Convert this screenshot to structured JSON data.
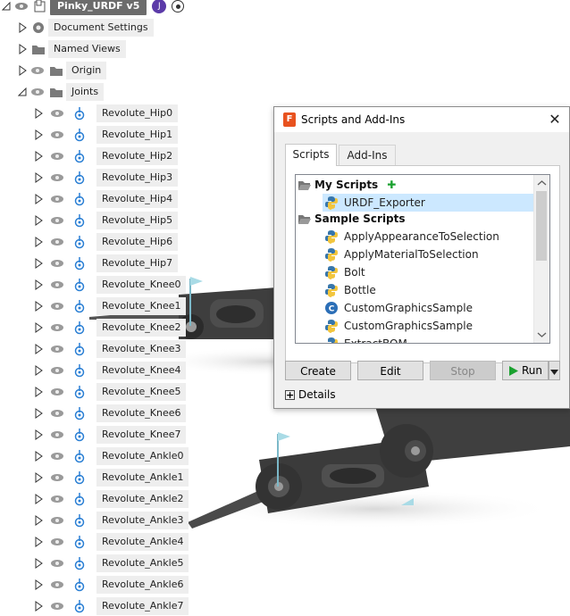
{
  "browser": {
    "root_label": "Pinky_URDF v5",
    "items": [
      {
        "label": "Document Settings",
        "icon": "gear-icon"
      },
      {
        "label": "Named Views",
        "icon": "folder-icon"
      },
      {
        "label": "Origin",
        "icon": "folder-icon"
      },
      {
        "label": "Joints",
        "icon": "folder-icon"
      }
    ],
    "joints": [
      "Revolute_Hip0",
      "Revolute_Hip1",
      "Revolute_Hip2",
      "Revolute_Hip3",
      "Revolute_Hip4",
      "Revolute_Hip5",
      "Revolute_Hip6",
      "Revolute_Hip7",
      "Revolute_Knee0",
      "Revolute_Knee1",
      "Revolute_Knee2",
      "Revolute_Knee3",
      "Revolute_Knee4",
      "Revolute_Knee5",
      "Revolute_Knee6",
      "Revolute_Knee7",
      "Revolute_Ankle0",
      "Revolute_Ankle1",
      "Revolute_Ankle2",
      "Revolute_Ankle3",
      "Revolute_Ankle4",
      "Revolute_Ankle5",
      "Revolute_Ankle6",
      "Revolute_Ankle7"
    ]
  },
  "dialog": {
    "title": "Scripts and Add-Ins",
    "app_icon_letter": "F",
    "close_glyph": "✕",
    "tabs": {
      "scripts": "Scripts",
      "addins": "Add-Ins"
    },
    "my_scripts_label": "My Scripts",
    "add_glyph": "✚",
    "my_scripts": [
      "URDF_Exporter"
    ],
    "sample_scripts_label": "Sample Scripts",
    "sample_scripts": [
      {
        "label": "ApplyAppearanceToSelection",
        "icon": "python-icon"
      },
      {
        "label": "ApplyMaterialToSelection",
        "icon": "python-icon"
      },
      {
        "label": "Bolt",
        "icon": "python-icon"
      },
      {
        "label": "Bottle",
        "icon": "python-icon"
      },
      {
        "label": "CustomGraphicsSample",
        "icon": "cpp-icon"
      },
      {
        "label": "CustomGraphicsSample",
        "icon": "python-icon"
      },
      {
        "label": "ExtractBOM",
        "icon": "python-icon"
      }
    ],
    "buttons": {
      "create": "Create",
      "edit": "Edit",
      "stop": "Stop",
      "run": "Run"
    },
    "details_label": "Details",
    "details_glyph": "+",
    "colors": {
      "accent_select": "#cce8ff",
      "run_green": "#1aa12f",
      "app_icon": "#e8521f"
    }
  }
}
